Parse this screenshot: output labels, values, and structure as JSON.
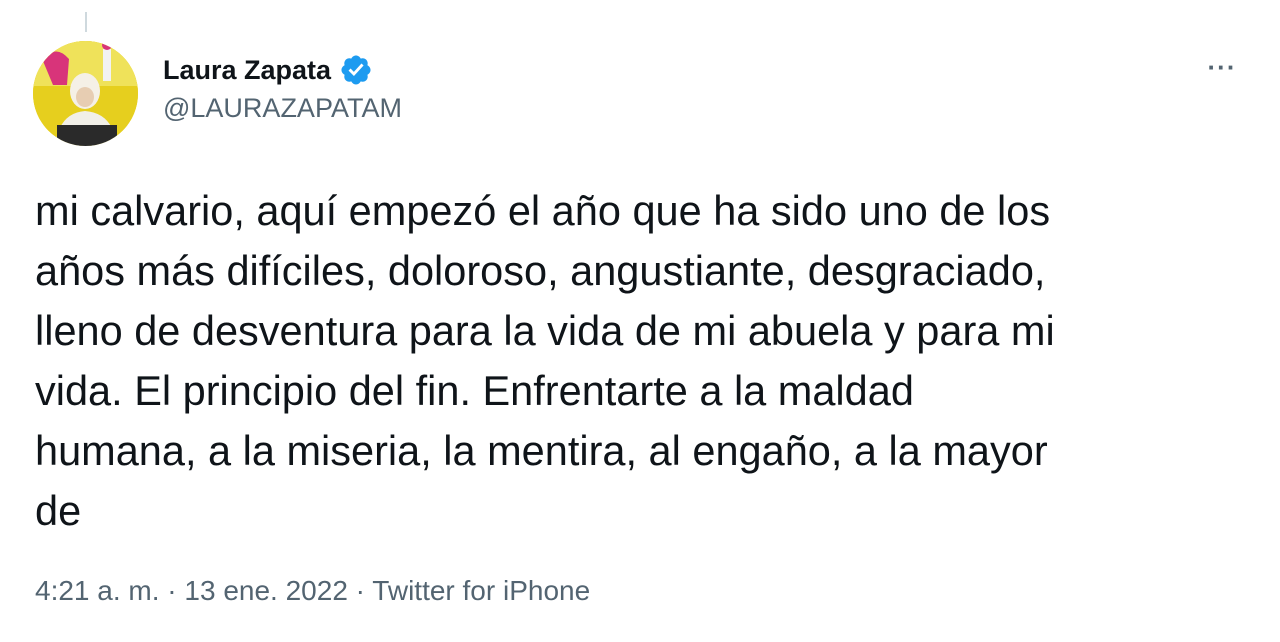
{
  "author": {
    "name": "Laura Zapata",
    "handle": "@LAURAZAPATAM",
    "verified": true
  },
  "menu": {
    "more_label": "···"
  },
  "tweet": {
    "lines": [
      "mi calvario, aquí empezó el año que ha sido uno de los",
      "años más difíciles, doloroso, angustiante, desgraciado,",
      "lleno de desventura para la vida de mi abuela y para mi",
      "vida. El principio del fin. Enfrentarte a la maldad",
      "humana, a la miseria, la mentira, al engaño, a la mayor",
      "de"
    ]
  },
  "meta": {
    "time": "4:21 a. m.",
    "separator": " · ",
    "date": "13 ene. 2022",
    "source": "Twitter for iPhone"
  },
  "colors": {
    "verified_badge": "#1d9bf0",
    "secondary_text": "#536471",
    "primary_text": "#0f1419"
  }
}
